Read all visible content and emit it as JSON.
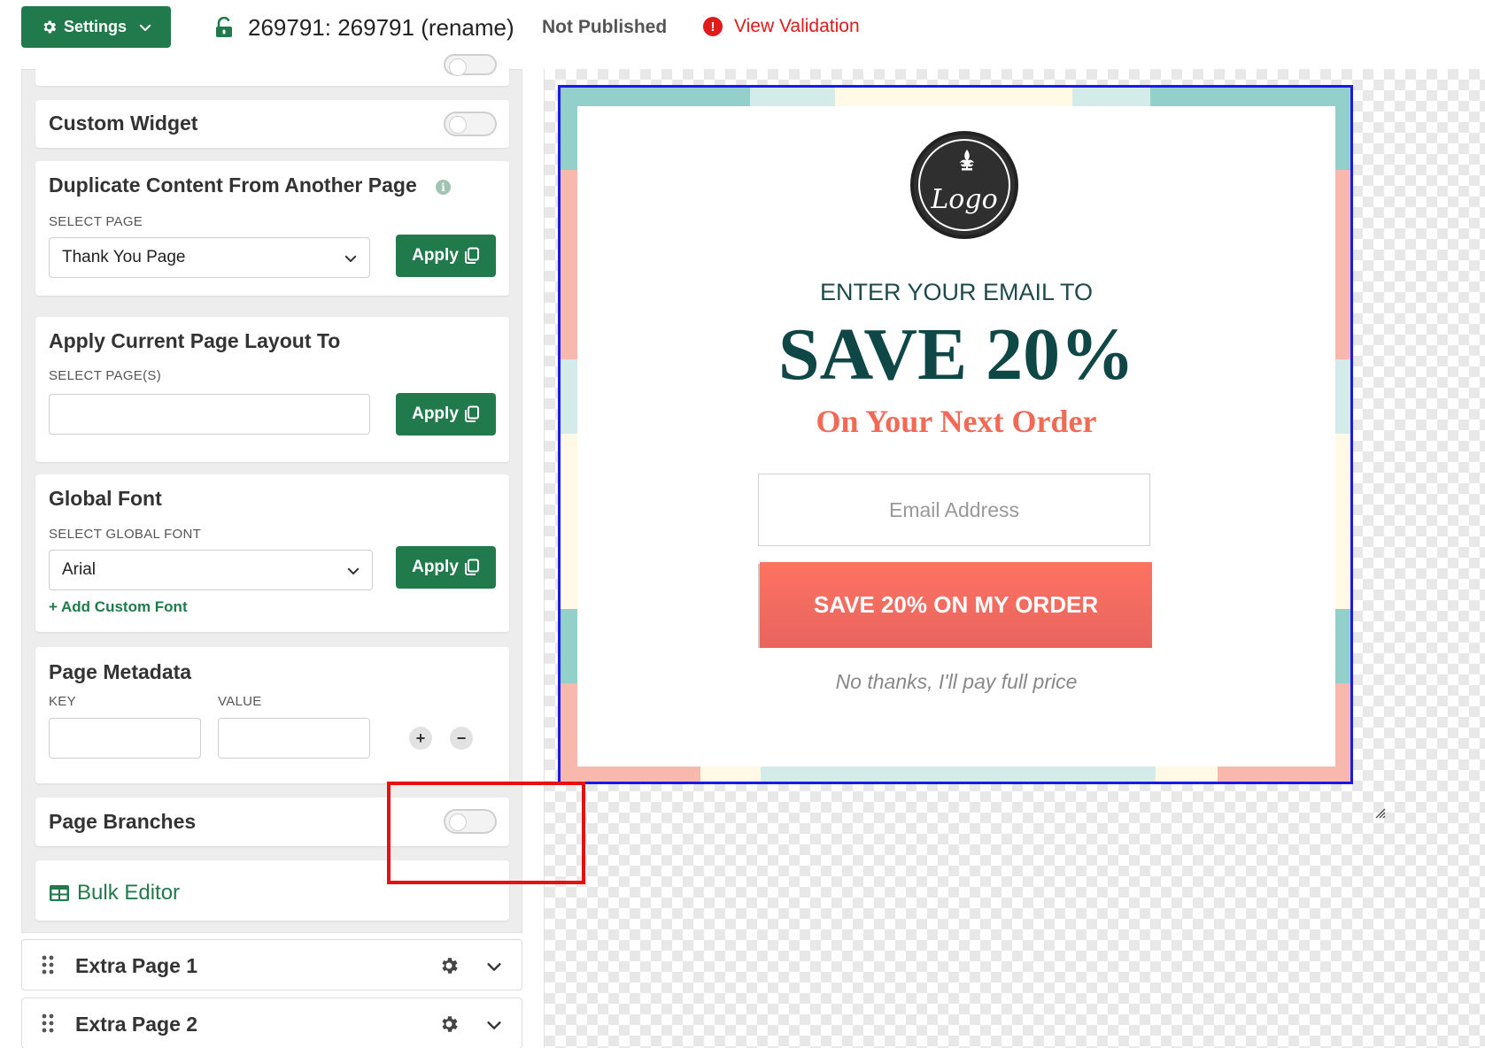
{
  "topbar": {
    "settings_label": "Settings",
    "page_title": "269791: 269791 (rename)",
    "publish_status": "Not Published",
    "validation_label": "View Validation",
    "icons": {
      "settings": "gear-icon",
      "dropdown": "chevron-down-icon",
      "lock": "unlock-icon",
      "warning": "exclamation-icon"
    }
  },
  "sidebar": {
    "custom_widget": {
      "title": "Custom Widget",
      "enabled": false
    },
    "duplicate": {
      "title": "Duplicate Content From Another Page",
      "select_label": "SELECT PAGE",
      "selected": "Thank You Page",
      "apply_label": "Apply"
    },
    "apply_layout": {
      "title": "Apply Current Page Layout To",
      "select_label": "SELECT PAGE(S)",
      "value": "",
      "apply_label": "Apply"
    },
    "global_font": {
      "title": "Global Font",
      "select_label": "SELECT GLOBAL FONT",
      "selected": "Arial",
      "apply_label": "Apply",
      "add_custom": "+ Add Custom Font"
    },
    "metadata": {
      "title": "Page Metadata",
      "key_label": "KEY",
      "value_label": "VALUE",
      "key_value": "",
      "value_value": "",
      "add_symbol": "+",
      "remove_symbol": "−"
    },
    "branches": {
      "title": "Page Branches",
      "enabled": false
    },
    "bulk_editor": {
      "label": "Bulk Editor"
    }
  },
  "extra_pages": [
    {
      "label": "Extra Page 1"
    },
    {
      "label": "Extra Page 2"
    }
  ],
  "popup": {
    "logo_text": "Logo",
    "enter_text": "ENTER YOUR EMAIL TO",
    "headline": "SAVE 20%",
    "subheadline": "On Your Next Order",
    "email_placeholder": "Email Address",
    "cta_label": "SAVE 20% ON MY ORDER",
    "decline_label": "No thanks, I'll pay full price"
  },
  "colors": {
    "brand_green": "#217a4b",
    "validation_red": "#e01b1b",
    "headline_teal": "#0f4646",
    "accent_coral": "#f06a55",
    "selection_blue": "#1a1ae6",
    "highlight_red": "#e61010"
  }
}
